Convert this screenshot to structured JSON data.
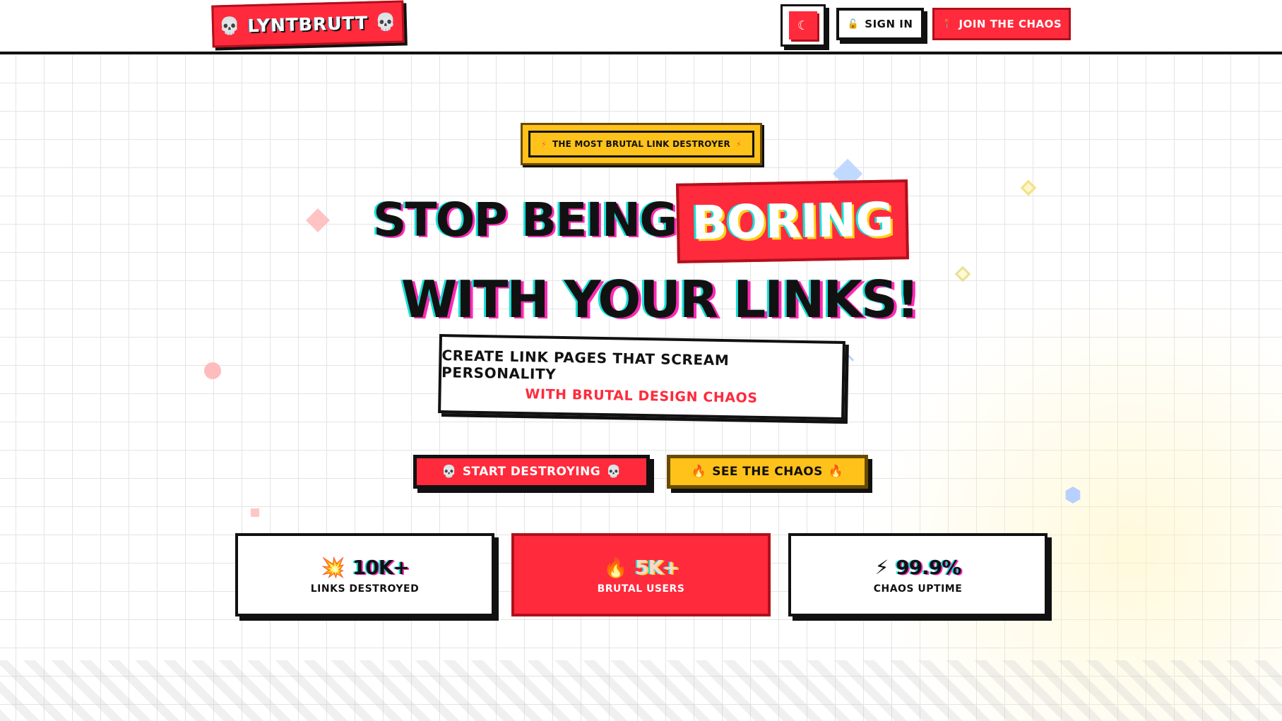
{
  "header": {
    "logo_text": "LYNTBRUTT",
    "logo_icon_left": "💀",
    "logo_icon_right": "💀",
    "theme_icon": "☾",
    "signin_icon": "🔓",
    "signin_label": "SIGN IN",
    "join_icon": "📍",
    "join_label": "JOIN THE CHAOS"
  },
  "hero": {
    "badge_bolt": "⚡",
    "badge_text": "THE MOST BRUTAL LINK DESTROYER",
    "headline_part1": "STOP BEING",
    "headline_highlight": "BORING",
    "headline_part2": "WITH YOUR LINKS!",
    "subtitle_line1": "CREATE LINK PAGES THAT SCREAM PERSONALITY",
    "subtitle_line2": "WITH BRUTAL DESIGN CHAOS"
  },
  "cta": {
    "primary_label": "START DESTROYING",
    "primary_icon": "💀",
    "secondary_label": "SEE THE CHAOS",
    "secondary_icon": "🔥"
  },
  "stats": [
    {
      "icon": "💥",
      "value": "10K+",
      "label": "LINKS DESTROYED"
    },
    {
      "icon": "🔥",
      "value": "5K+",
      "label": "BRUTAL USERS"
    },
    {
      "icon": "⚡",
      "value": "99.9%",
      "label": "CHAOS UPTIME"
    }
  ],
  "colors": {
    "accent_red": "#ff2a3c",
    "accent_yellow": "#ffc21a",
    "ink": "#111111",
    "glitch_cyan": "#19e0d8",
    "glitch_magenta": "#ff2ab5"
  }
}
